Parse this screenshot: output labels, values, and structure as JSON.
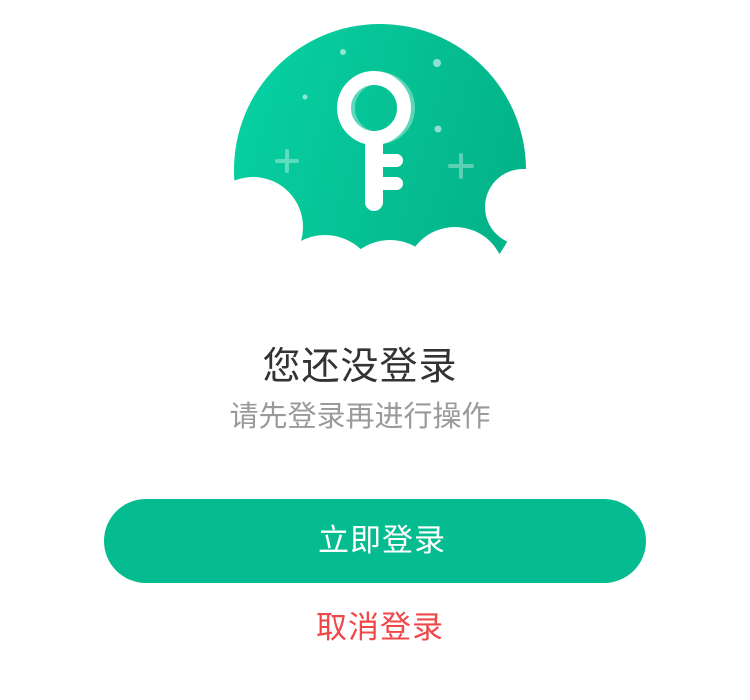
{
  "empty_state": {
    "icon": "key-icon",
    "title": "您还没登录",
    "subtitle": "请先登录再进行操作"
  },
  "actions": {
    "login_label": "立即登录",
    "cancel_label": "取消登录"
  },
  "colors": {
    "primary": "#04bc8f",
    "cancel": "#f04848",
    "title": "#333333",
    "subtitle": "#9a9a9a"
  }
}
